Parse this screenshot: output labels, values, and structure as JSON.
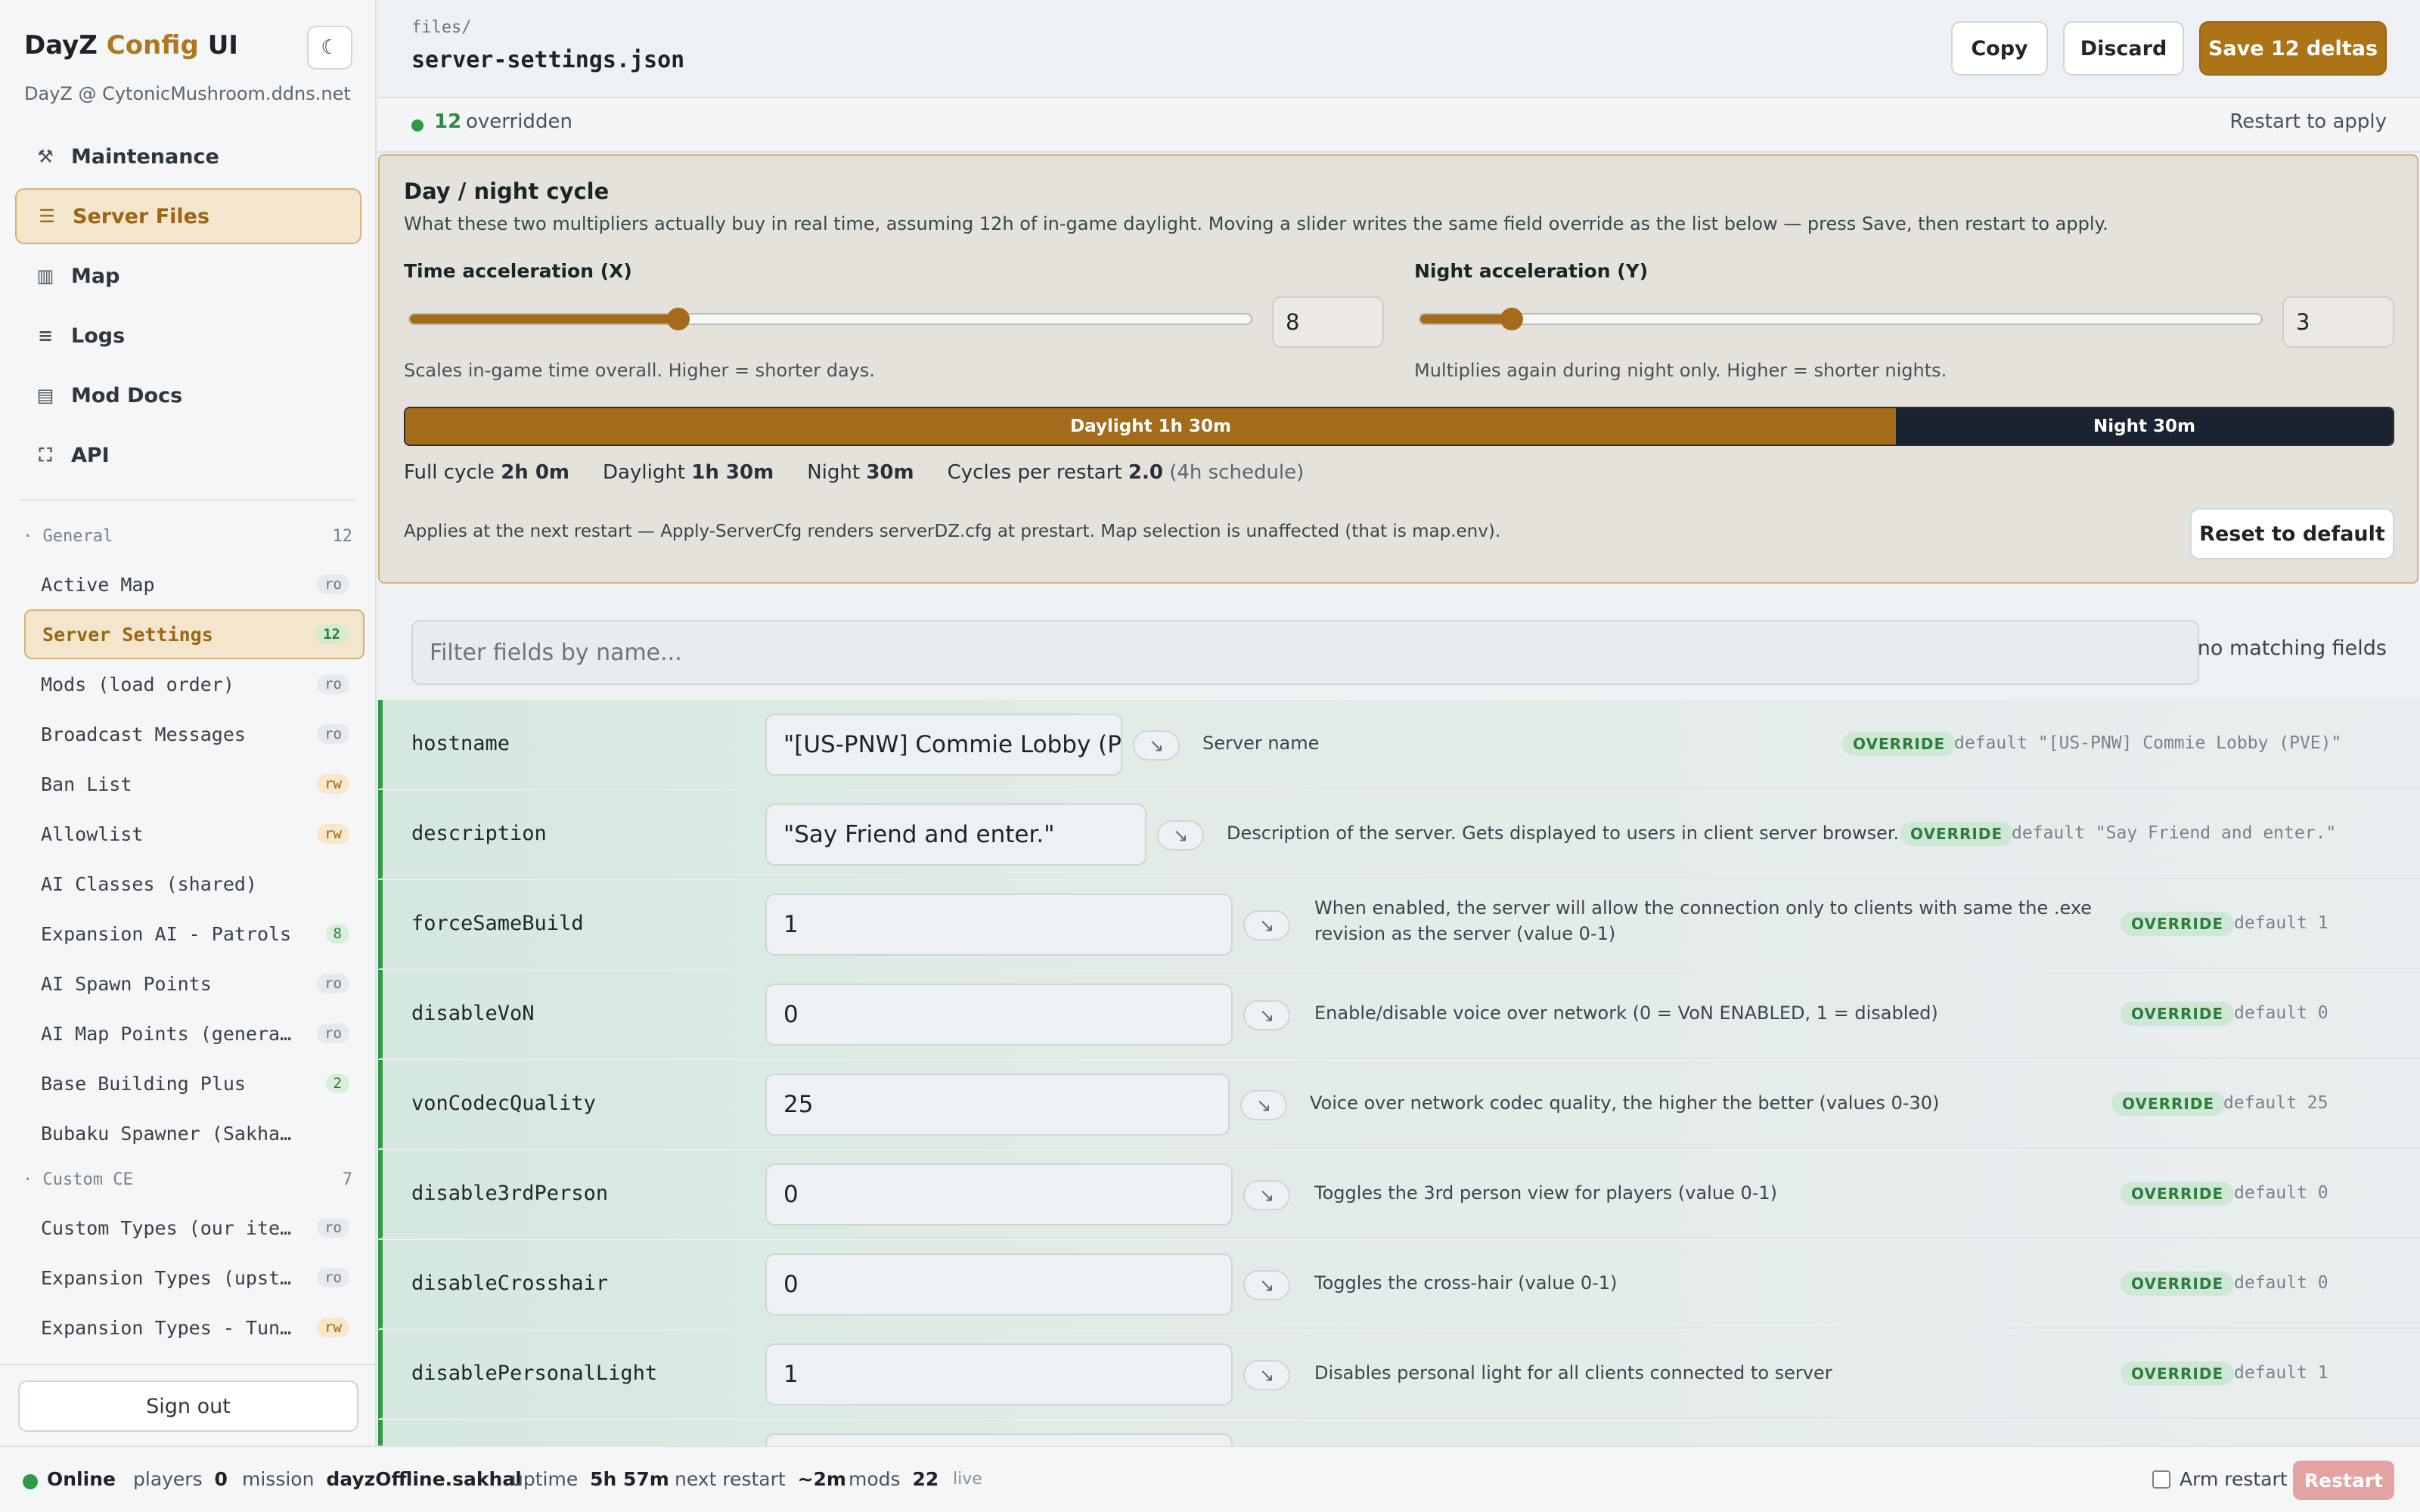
{
  "sidebar": {
    "brand_pre": "DayZ",
    "brand_accent": "Config",
    "brand_post": "UI",
    "theme_icon": "☾",
    "server_host": "DayZ @ CytonicMushroom.ddns.net",
    "nav": [
      {
        "label": "Maintenance",
        "icon": "wrench-icon",
        "glyph": "🔧"
      },
      {
        "label": "Server Files",
        "icon": "server-icon",
        "glyph": "☰"
      },
      {
        "label": "Map",
        "icon": "map-icon",
        "glyph": "▥"
      },
      {
        "label": "Logs",
        "icon": "lines-icon",
        "glyph": "≡"
      },
      {
        "label": "Mod Docs",
        "icon": "document-icon",
        "glyph": "▤"
      },
      {
        "label": "API",
        "icon": "brackets-icon",
        "glyph": "⛶"
      }
    ],
    "groups": {
      "general": {
        "label": "General",
        "count": "12"
      },
      "custom": {
        "label": "Custom CE",
        "count": "7"
      }
    },
    "general_files": [
      {
        "name": "Active Map",
        "tag": "ro"
      },
      {
        "name": "Server Settings",
        "tag": "12"
      },
      {
        "name": "Mods (load order)",
        "tag": "ro"
      },
      {
        "name": "Broadcast Messages",
        "tag": "ro"
      },
      {
        "name": "Ban List",
        "tag": "rw"
      },
      {
        "name": "Allowlist",
        "tag": "rw"
      },
      {
        "name": "AI Classes (shared)",
        "tag": ""
      },
      {
        "name": "Expansion AI - Patrols",
        "tag": "8"
      },
      {
        "name": "AI Spawn Points",
        "tag": "ro"
      },
      {
        "name": "AI Map Points (generated)",
        "tag": "ro"
      },
      {
        "name": "Base Building Plus",
        "tag": "2"
      },
      {
        "name": "Bubaku Spawner (Sakhal)",
        "tag": ""
      }
    ],
    "custom_files": [
      {
        "name": "Custom Types (our items)",
        "tag": "ro"
      },
      {
        "name": "Expansion Types (upstream)",
        "tag": "ro"
      },
      {
        "name": "Expansion Types - Tuning",
        "tag": "rw"
      }
    ],
    "sign_out": "Sign out"
  },
  "header": {
    "crumb": "files/",
    "filename": "server-settings.json",
    "copy": "Copy",
    "discard": "Discard",
    "save": "Save 12 deltas"
  },
  "subbar": {
    "count": "12",
    "label": "overridden",
    "restart_hint": "Restart to apply"
  },
  "daynight": {
    "title": "Day / night cycle",
    "description": "What these two multipliers actually buy in real time, assuming 12h of in-game daylight. Moving a slider writes the same field override as the list below — press Save, then restart to apply.",
    "time_label": "Time acceleration (X)",
    "time_value": "8",
    "time_fraction": 0.32,
    "time_help": "Scales in-game time overall. Higher = shorter days.",
    "night_label": "Night acceleration (Y)",
    "night_value": "3",
    "night_fraction": 0.11,
    "night_help": "Multiplies again during night only. Higher = shorter nights.",
    "day_fraction": 0.75,
    "day_bar": "Daylight 1h 30m",
    "night_bar": "Night 30m",
    "full_cycle_label": "Full cycle",
    "full_cycle": "2h 0m",
    "daylight_label": "Daylight",
    "daylight": "1h 30m",
    "night_label_s": "Night",
    "night": "30m",
    "cycles_label": "Cycles per restart",
    "cycles": "2.0",
    "cycles_note": "(4h schedule)",
    "applies": "Applies at the next restart — Apply-ServerCfg renders serverDZ.cfg at prestart. Map selection is unaffected (that is map.env).",
    "reset": "Reset to default"
  },
  "filter": {
    "placeholder": "Filter fields by name...",
    "no_match": "no matching fields"
  },
  "fields": [
    {
      "name": "hostname",
      "value": "\"[US-PNW] Commie Lobby (PVE)\"",
      "desc": "Server name",
      "badge": "OVERRIDE",
      "default": "default \"[US-PNW] Commie Lobby (PVE)\""
    },
    {
      "name": "description",
      "value": "\"Say Friend and enter.\"",
      "desc": "Description of the server. Gets displayed to users in client server browser.",
      "badge": "OVERRIDE",
      "default": "default \"Say Friend and enter.\""
    },
    {
      "name": "forceSameBuild",
      "value": "1",
      "desc": "When enabled, the server will allow the connection only to clients with same the .exe revision as the server (value 0-1)",
      "badge": "OVERRIDE",
      "default": "default 1"
    },
    {
      "name": "disableVoN",
      "value": "0",
      "desc": "Enable/disable voice over network (0 = VoN ENABLED, 1 = disabled)",
      "badge": "OVERRIDE",
      "default": "default 0"
    },
    {
      "name": "vonCodecQuality",
      "value": "25",
      "desc": "Voice over network codec quality, the higher the better (values 0-30)",
      "badge": "OVERRIDE",
      "default": "default 25"
    },
    {
      "name": "disable3rdPerson",
      "value": "0",
      "desc": "Toggles the 3rd person view for players (value 0-1)",
      "badge": "OVERRIDE",
      "default": "default 0"
    },
    {
      "name": "disableCrosshair",
      "value": "0",
      "desc": "Toggles the cross-hair (value 0-1)",
      "badge": "OVERRIDE",
      "default": "default 0"
    },
    {
      "name": "disablePersonalLight",
      "value": "1",
      "desc": "Disables personal light for all clients connected to server",
      "badge": "OVERRIDE",
      "default": "default 1"
    }
  ],
  "status": {
    "online": "Online",
    "players_label": "players",
    "players": "0",
    "mission_label": "mission",
    "mission": "dayzOffline.sakhal",
    "uptime_label": "uptime",
    "uptime": "5h 57m",
    "next_label": "next restart",
    "next": "~2m",
    "mods_label": "mods",
    "mods": "22",
    "live": "live",
    "arm": "Arm restart",
    "restart": "Restart"
  },
  "colors": {
    "accent": "#ad7317",
    "override_green": "#2f9a46",
    "night_bar": "#1c2330"
  }
}
